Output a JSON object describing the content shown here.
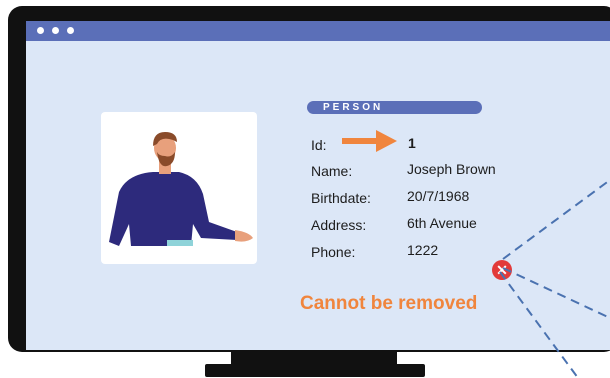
{
  "window": {
    "titlebar_color": "#5b6fb8",
    "dots": [
      "window-dot",
      "window-dot",
      "window-dot"
    ]
  },
  "person": {
    "badge": "PERSON",
    "fields": [
      {
        "label": "Id:",
        "value": "1"
      },
      {
        "label": "Name:",
        "value": "Joseph Brown"
      },
      {
        "label": "Birthdate:",
        "value": "20/7/1968"
      },
      {
        "label": "Address:",
        "value": "6th Avenue"
      },
      {
        "label": "Phone:",
        "value": "1222"
      }
    ]
  },
  "error": {
    "icon": "close-icon",
    "icon_glyph": "✕",
    "message": "Cannot be removed",
    "color": "#f0853d"
  },
  "colors": {
    "screen_bg": "#dce7f7",
    "accent": "#5b6fb8",
    "arrow": "#f0853d",
    "error_red": "#e23a3a"
  }
}
